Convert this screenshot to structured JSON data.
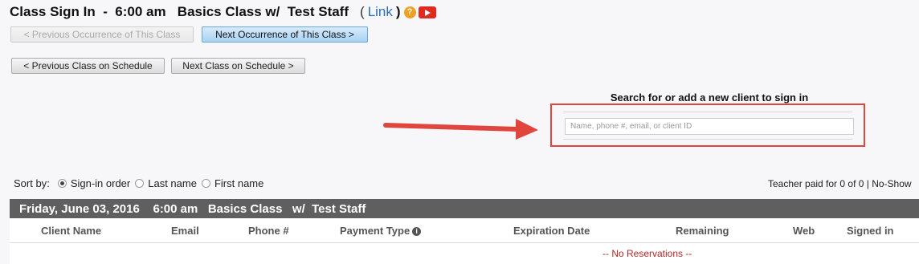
{
  "header": {
    "title": "Class Sign In  -  6:00 am   Basics Class w/  Test Staff",
    "paren_open": "(",
    "link_text": "Link",
    "paren_close": ")",
    "help_icon_glyph": "?",
    "video_icon": "youtube-play-icon"
  },
  "nav": {
    "prev_occurrence": "< Previous Occurrence of This Class",
    "next_occurrence": "Next Occurrence of This Class >",
    "prev_class": "< Previous Class on Schedule",
    "next_class": "Next Class on Schedule >"
  },
  "search": {
    "label": "Search for or add a new client to sign in",
    "placeholder": "Name, phone #, email, or client ID",
    "value": ""
  },
  "sort": {
    "label": "Sort by",
    "colon": ":",
    "options": [
      {
        "label": "Sign-in order",
        "selected": true
      },
      {
        "label": "Last name",
        "selected": false
      },
      {
        "label": "First name",
        "selected": false
      }
    ]
  },
  "teacher_paid": "Teacher paid for 0 of 0 | No-Show",
  "class_bar": "Friday, June 03, 2016    6:00 am   Basics Class   w/  Test Staff",
  "table": {
    "columns": [
      "Client Name",
      "Email",
      "Phone #",
      "Payment Type",
      "Expiration Date",
      "Remaining",
      "Web",
      "Signed in"
    ],
    "payment_info_icon": "i",
    "empty_message": "-- No Reservations --"
  },
  "colors": {
    "accent_red": "#e0463d",
    "link_blue": "#2a6ebb",
    "class_bar_bg": "#5f5f5f"
  }
}
